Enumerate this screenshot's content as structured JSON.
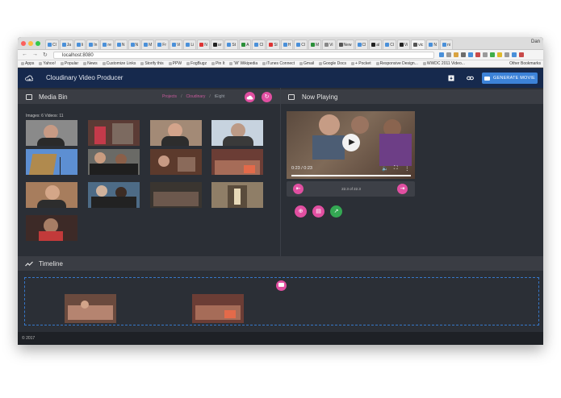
{
  "browser": {
    "tabs": [
      {
        "label": "Cl",
        "color": "#4a90d9"
      },
      {
        "label": "Ja",
        "color": "#4a90d9"
      },
      {
        "label": "li",
        "color": "#4a90d9"
      },
      {
        "label": "In",
        "color": "#4a90d9"
      },
      {
        "label": "re",
        "color": "#4a90d9"
      },
      {
        "label": "N",
        "color": "#4a90d9"
      },
      {
        "label": "N",
        "color": "#4a90d9"
      },
      {
        "label": "M",
        "color": "#4a90d9"
      },
      {
        "label": "Fr",
        "color": "#4a90d9"
      },
      {
        "label": "Vi",
        "color": "#4a90d9"
      },
      {
        "label": "Li",
        "color": "#4a90d9"
      },
      {
        "label": "N",
        "color": "#d33"
      },
      {
        "label": "ar",
        "color": "#222"
      },
      {
        "label": "St",
        "color": "#4a90d9"
      },
      {
        "label": "A",
        "color": "#2a8f3a"
      },
      {
        "label": "Cl",
        "color": "#4a90d9"
      },
      {
        "label": "Sl",
        "color": "#d33"
      },
      {
        "label": "H",
        "color": "#4a90d9"
      },
      {
        "label": "Cl",
        "color": "#4a90d9"
      },
      {
        "label": "M",
        "color": "#2a8f3a"
      },
      {
        "label": "Vi",
        "color": "#888"
      },
      {
        "label": "New",
        "color": "#555"
      },
      {
        "label": "Cl",
        "color": "#4a90d9"
      },
      {
        "label": "al",
        "color": "#222"
      },
      {
        "label": "Cl",
        "color": "#4a90d9"
      },
      {
        "label": "Vi",
        "color": "#222"
      },
      {
        "label": "vic",
        "color": "#555",
        "active": true
      },
      {
        "label": "N",
        "color": "#4a90d9"
      },
      {
        "label": "ni",
        "color": "#4a90d9"
      }
    ],
    "user": "Dan",
    "url": "localhost:8080",
    "bookmarks": [
      "Apps",
      "Yahoo!",
      "Popular",
      "News",
      "Customize Links",
      "Storify this",
      "PPW",
      "FogBugz",
      "Pin It",
      "'W' Wikipedia",
      "iTunes Connect",
      "Gmail",
      "Google Docs",
      "+ Pocket",
      "Responsive Design...",
      "WWDC 2011 Video..."
    ],
    "other_bookmarks": "Other Bookmarks",
    "ext_colors": [
      "#4a90d9",
      "#9a9a9a",
      "#d9a341",
      "#6c6c6c",
      "#4a90d9",
      "#c94a4a",
      "#9a9a9a",
      "#3fae49",
      "#e0b92c",
      "#9a9a9a",
      "#4a90d9",
      "#c94a4a"
    ]
  },
  "app": {
    "title": "Cloudinary Video Producer",
    "generate_label": "GENERATE MOVIE",
    "accent": "#e14fa1",
    "header_bg": "#16294d"
  },
  "media_bin": {
    "title": "Media Bin",
    "breadcrumb": [
      "Projects",
      "Cloudinary",
      "tEight"
    ],
    "counts": "Images: 6 Videos: 11"
  },
  "now_playing": {
    "title": "Now Playing",
    "time": "0:23 / 0:23",
    "trim_label": "22.3 of 22.3",
    "progress": 1.0
  },
  "timeline": {
    "title": "Timeline"
  },
  "footer": {
    "copyright": "© 2017"
  }
}
